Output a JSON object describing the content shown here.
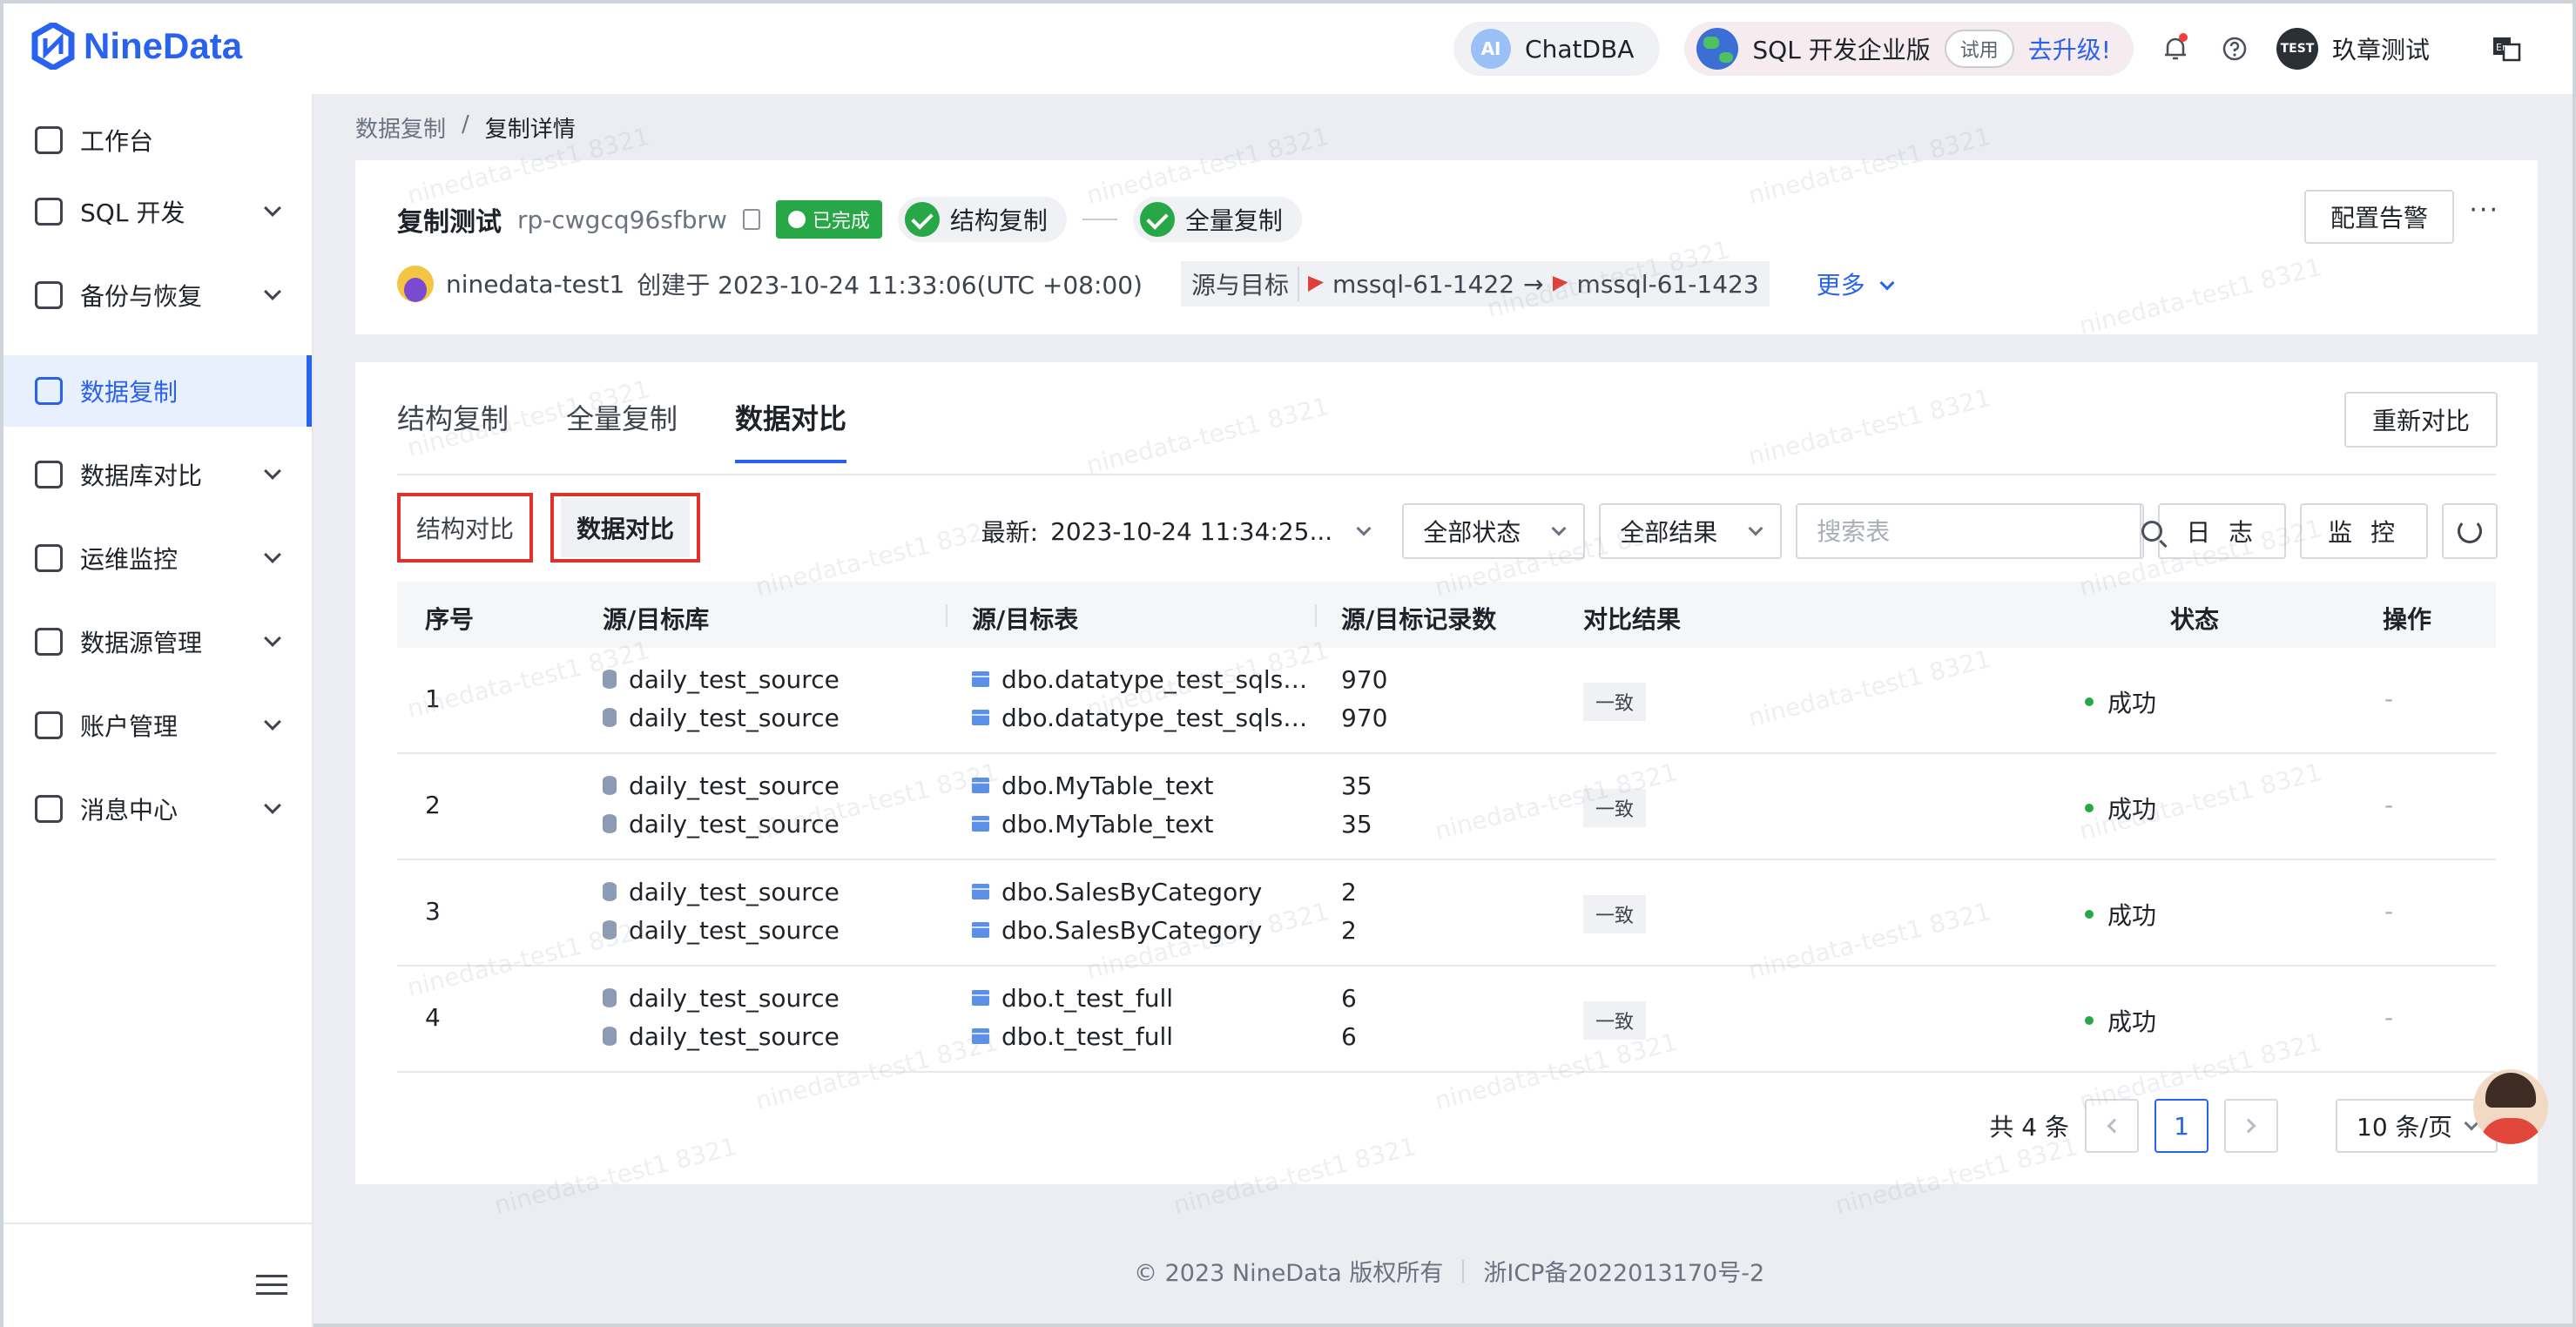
{
  "brand": {
    "name": "NineData",
    "color": "#2a62f0"
  },
  "header": {
    "chatdba_label": "ChatDBA",
    "ai_badge": "AI",
    "edition_label": "SQL 开发企业版",
    "trial_tag": "试用",
    "upgrade_label": "去升级!",
    "user_avatar_text": "TEST",
    "user_name": "玖章测试",
    "bell_icon": "bell-icon",
    "help_icon": "help-icon",
    "lang_icon": "language-switch-icon"
  },
  "sidebar": {
    "items": [
      {
        "label": "工作台",
        "icon": "home-icon",
        "expandable": false,
        "active": false
      },
      {
        "label": "SQL 开发",
        "icon": "sql-icon",
        "expandable": true,
        "active": false
      },
      {
        "label": "备份与恢复",
        "icon": "backup-icon",
        "expandable": true,
        "active": false
      },
      {
        "label": "数据复制",
        "icon": "replication-icon",
        "expandable": false,
        "active": true
      },
      {
        "label": "数据库对比",
        "icon": "compare-icon",
        "expandable": true,
        "active": false
      },
      {
        "label": "运维监控",
        "icon": "monitor-icon",
        "expandable": true,
        "active": false
      },
      {
        "label": "数据源管理",
        "icon": "datasource-icon",
        "expandable": true,
        "active": false
      },
      {
        "label": "账户管理",
        "icon": "account-icon",
        "expandable": true,
        "active": false
      },
      {
        "label": "消息中心",
        "icon": "message-icon",
        "expandable": true,
        "active": false
      }
    ],
    "collapse_icon": "collapse-menu-icon"
  },
  "breadcrumb": {
    "parent": "数据复制",
    "separator": "/",
    "current": "复制详情"
  },
  "task": {
    "title": "复制测试",
    "id": "rp-cwgcq96sfbrw",
    "status": "已完成",
    "stages": [
      "结构复制",
      "全量复制"
    ],
    "creator": "ninedata-test1",
    "created_text": "创建于 2023-10-24 11:33:06(UTC +08:00)",
    "source_target_label": "源与目标",
    "source": "mssql-61-1422",
    "arrow": "→",
    "target": "mssql-61-1423",
    "more_label": "更多",
    "alert_button": "配置告警",
    "more_menu": "···"
  },
  "tabs": [
    {
      "label": "结构复制",
      "active": false
    },
    {
      "label": "全量复制",
      "active": false
    },
    {
      "label": "数据对比",
      "active": true
    }
  ],
  "recompare_button": "重新对比",
  "sub_tabs": {
    "structure": "结构对比",
    "data": "数据对比"
  },
  "toolbar": {
    "latest_label": "最新:",
    "latest_value": "2023-10-24 11:34:25...",
    "status_filter": "全部状态",
    "result_filter": "全部结果",
    "search_placeholder": "搜索表",
    "log_button": "日 志",
    "monitor_button": "监 控"
  },
  "table": {
    "headers": [
      "序号",
      "源/目标库",
      "源/目标表",
      "源/目标记录数",
      "对比结果",
      "状态",
      "操作"
    ],
    "rows": [
      {
        "index": "1",
        "src_db": "daily_test_source",
        "dst_db": "daily_test_source",
        "src_table": "dbo.datatype_test_sqlse...",
        "dst_table": "dbo.datatype_test_sqlse...",
        "src_count": "970",
        "dst_count": "970",
        "result": "一致",
        "status": "成功",
        "op": "-"
      },
      {
        "index": "2",
        "src_db": "daily_test_source",
        "dst_db": "daily_test_source",
        "src_table": "dbo.MyTable_text",
        "dst_table": "dbo.MyTable_text",
        "src_count": "35",
        "dst_count": "35",
        "result": "一致",
        "status": "成功",
        "op": "-"
      },
      {
        "index": "3",
        "src_db": "daily_test_source",
        "dst_db": "daily_test_source",
        "src_table": "dbo.SalesByCategory",
        "dst_table": "dbo.SalesByCategory",
        "src_count": "2",
        "dst_count": "2",
        "result": "一致",
        "status": "成功",
        "op": "-"
      },
      {
        "index": "4",
        "src_db": "daily_test_source",
        "dst_db": "daily_test_source",
        "src_table": "dbo.t_test_full",
        "dst_table": "dbo.t_test_full",
        "src_count": "6",
        "dst_count": "6",
        "result": "一致",
        "status": "成功",
        "op": "-"
      }
    ]
  },
  "pagination": {
    "total_text": "共 4 条",
    "current_page": "1",
    "page_size": "10 条/页"
  },
  "footer": {
    "copyright": "© 2023 NineData 版权所有",
    "icp": "浙ICP备2022013170号-2"
  },
  "watermark": "ninedata-test1 8321"
}
